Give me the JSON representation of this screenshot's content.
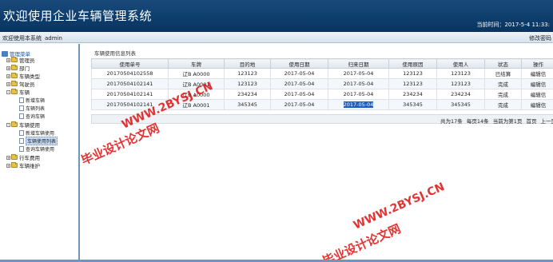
{
  "header": {
    "title": "欢迎使用企业车辆管理系统",
    "time_label": "当前时间：",
    "time_value": "2017-5-4 11:33:"
  },
  "subbar": {
    "welcome_text": "欢迎使用本系统",
    "username": "admin",
    "change_password": "修改密码"
  },
  "sidebar": {
    "root": "管理菜单",
    "items": [
      {
        "label": "管理员",
        "expander": "+"
      },
      {
        "label": "部门",
        "expander": "+"
      },
      {
        "label": "车辆类型",
        "expander": "+"
      },
      {
        "label": "驾驶员",
        "expander": "+"
      },
      {
        "label": "车辆",
        "expander": "-",
        "children": [
          "新增车辆",
          "车辆列表",
          "查询车辆"
        ]
      },
      {
        "label": "车辆使用",
        "expander": "-",
        "children": [
          "新增车辆使用",
          "车辆使用列表",
          "查询车辆使用"
        ]
      },
      {
        "label": "行车费用",
        "expander": "+"
      },
      {
        "label": "车辆维护",
        "expander": "+"
      }
    ]
  },
  "main": {
    "panel_title": "车辆使用信息列表",
    "columns": [
      "使用单号",
      "车牌",
      "目的地",
      "使用日期",
      "归来日期",
      "使用原因",
      "使用人",
      "状态",
      "操作"
    ],
    "rows": [
      [
        "20170504102558",
        "辽B A0000",
        "123123",
        "2017-05-04",
        "2017-05-04",
        "123123",
        "123123",
        "已结算",
        "编辑信"
      ],
      [
        "20170504102141",
        "辽B A0001",
        "123123",
        "2017-05-04",
        "2017-05-04",
        "123123",
        "123123",
        "完成",
        "编辑信"
      ],
      [
        "20170504102141",
        "辽B A0000",
        "234234",
        "2017-05-04",
        "2017-05-04",
        "234234",
        "234234",
        "完成",
        "编辑信"
      ],
      [
        "20170504102141",
        "辽B A0001",
        "345345",
        "2017-05-04",
        "2017-05-04",
        "345345",
        "345345",
        "完成",
        "编辑信"
      ]
    ],
    "pager": {
      "total": "共为17条",
      "per_page": "每页14条",
      "current": "当前为第1页",
      "first": "首页",
      "prev": "上一页",
      "next": "下一"
    }
  },
  "watermarks": [
    "WWW.2BYSJ.CN",
    "毕业设计论文网",
    "WWW.2BYSJ.CN",
    "毕业设计论文网"
  ],
  "colors": {
    "header_bg": "#0d3d6b",
    "watermark": "#e01010",
    "selection": "#1f5fc2"
  }
}
